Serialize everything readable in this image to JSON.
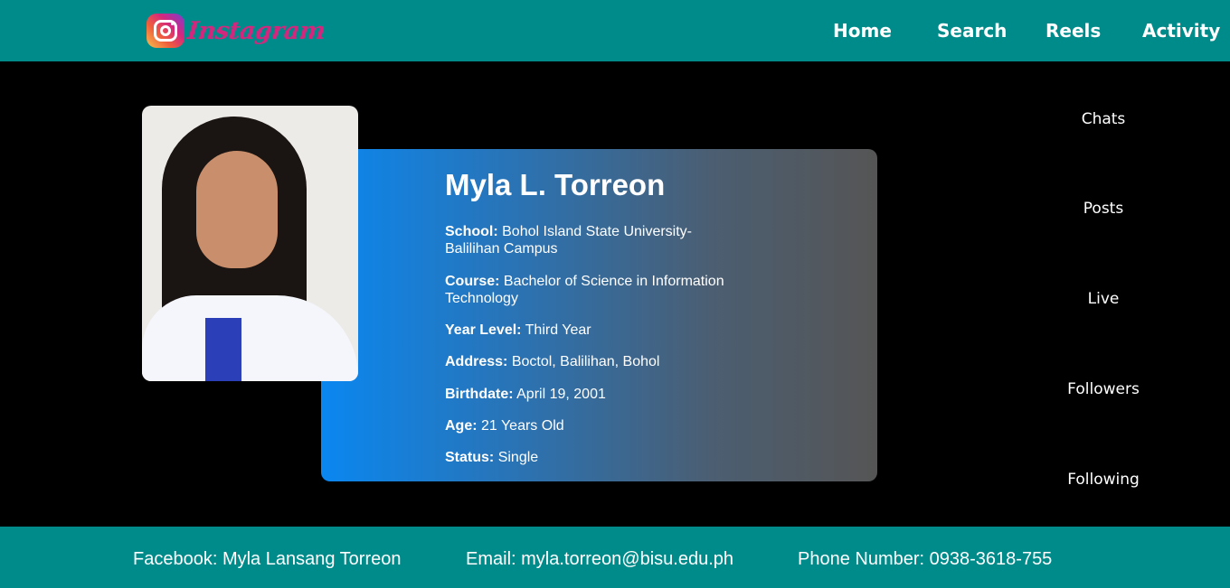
{
  "header": {
    "logo_text": "Instagram",
    "logo_icon": "instagram-camera-icon",
    "nav": [
      "Home",
      "Search",
      "Reels",
      "Activity"
    ]
  },
  "sidebar": {
    "items": [
      "Chats",
      "Posts",
      "Live",
      "Followers",
      "Following"
    ]
  },
  "profile": {
    "name": "Myla L. Torreon",
    "fields": [
      {
        "label": "School:",
        "value": "Bohol Island State University-Balilihan Campus"
      },
      {
        "label": "Course:",
        "value": "Bachelor of Science in Information Technology"
      },
      {
        "label": "Year Level:",
        "value": "Third Year"
      },
      {
        "label": "Address:",
        "value": "Boctol, Balilihan, Bohol"
      },
      {
        "label": "Birthdate:",
        "value": "April 19, 2001"
      },
      {
        "label": "Age:",
        "value": "21 Years Old"
      },
      {
        "label": "Status:",
        "value": "Single"
      }
    ]
  },
  "footer": {
    "facebook": "Facebook: Myla Lansang Torreon",
    "email": "Email: myla.torreon@bisu.edu.ph",
    "phone": "Phone Number: 0938-3618-755"
  },
  "colors": {
    "bar": "#008b8b",
    "background": "#000000",
    "card_gradient_start": "#0a87f0",
    "card_gradient_end": "#555555"
  }
}
